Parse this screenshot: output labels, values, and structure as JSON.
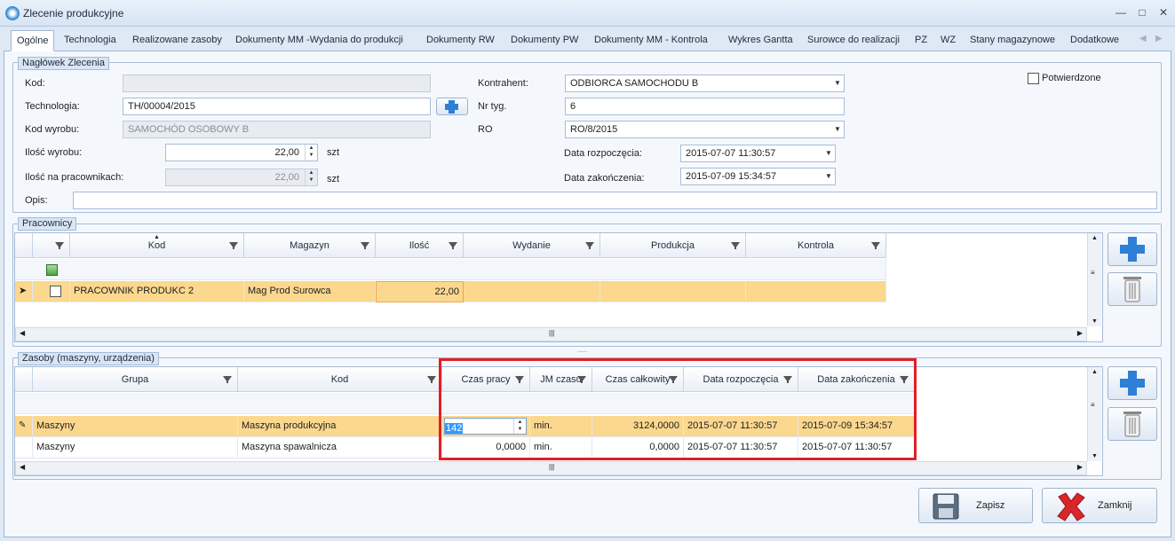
{
  "window": {
    "title": "Zlecenie produkcyjne"
  },
  "tabs": [
    "Ogólne",
    "Technologia",
    "Realizowane zasoby",
    "Dokumenty MM -Wydania do produkcji",
    "Dokumenty RW",
    "Dokumenty PW",
    "Dokumenty MM - Kontrola",
    "Wykres Gantta",
    "Surowce do realizacji",
    "PZ",
    "WZ",
    "Stany magazynowe",
    "Dodatkowe"
  ],
  "header": {
    "caption": "Nagłówek Zlecenia",
    "kod_label": "Kod:",
    "kod_value": "",
    "technologia_label": "Technologia:",
    "technologia_value": "TH/00004/2015",
    "kod_wyrobu_label": "Kod wyrobu:",
    "kod_wyrobu_value": "SAMOCHÓD OSOBOWY B",
    "ilosc_wyrobu_label": "Ilość wyrobu:",
    "ilosc_wyrobu_value": "22,00",
    "ilosc_wyrobu_unit": "szt",
    "ilosc_prac_label": "Ilość na pracownikach:",
    "ilosc_prac_value": "22,00",
    "ilosc_prac_unit": "szt",
    "opis_label": "Opis:",
    "opis_value": "",
    "kontrahent_label": "Kontrahent:",
    "kontrahent_value": "ODBIORCA SAMOCHODU B",
    "nr_tyg_label": "Nr tyg.",
    "nr_tyg_value": "6",
    "ro_label": "RO",
    "ro_value": "RO/8/2015",
    "data_rozp_label": "Data rozpoczęcia:",
    "data_rozp_value": "2015-07-07 11:30:57",
    "data_zak_label": "Data zakończenia:",
    "data_zak_value": "2015-07-09 15:34:57",
    "potwierdzone_label": "Potwierdzone"
  },
  "pracownicy": {
    "caption": "Pracownicy",
    "columns": [
      "Kod",
      "Magazyn",
      "Ilość",
      "Wydanie",
      "Produkcja",
      "Kontrola"
    ],
    "rows": [
      {
        "kod": "PRACOWNIK PRODUKC 2",
        "magazyn": "Mag Prod Surowca",
        "ilosc": "22,00",
        "wydanie": "",
        "produkcja": "",
        "kontrola": ""
      }
    ]
  },
  "zasoby": {
    "caption": "Zasoby (maszyny, urządzenia)",
    "columns": [
      "Grupa",
      "Kod",
      "Czas pracy",
      "JM czasu",
      "Czas całkowity",
      "Data rozpoczęcia",
      "Data zakończenia"
    ],
    "rows": [
      {
        "grupa": "Maszyny",
        "kod": "Maszyna produkcyjna",
        "czas_pracy": "142",
        "jm": "min.",
        "czas_calk": "3124,0000",
        "data_rozp": "2015-07-07 11:30:57",
        "data_zak": "2015-07-09 15:34:57"
      },
      {
        "grupa": "Maszyny",
        "kod": "Maszyna spawalnicza",
        "czas_pracy": "0,0000",
        "jm": "min.",
        "czas_calk": "0,0000",
        "data_rozp": "2015-07-07 11:30:57",
        "data_zak": "2015-07-07 11:30:57"
      }
    ]
  },
  "buttons": {
    "save": "Zapisz",
    "close": "Zamknij"
  },
  "colors": {
    "accent": "#2e7fd6",
    "selected_row": "#fbd88e",
    "highlight": "#e21f26"
  }
}
